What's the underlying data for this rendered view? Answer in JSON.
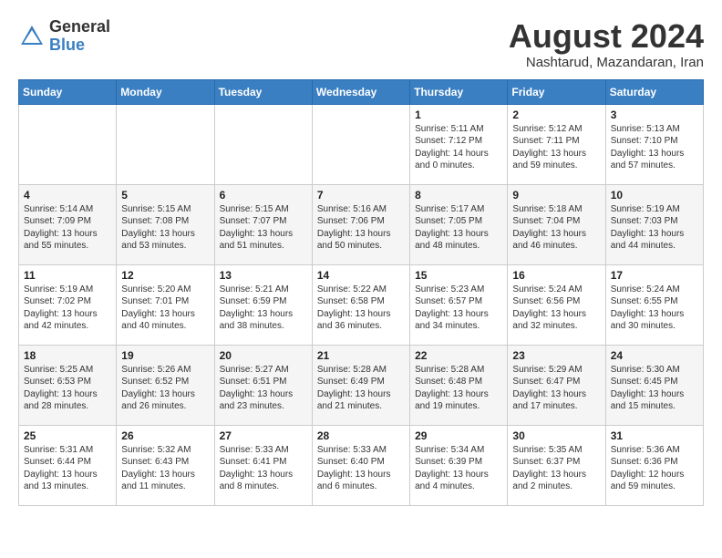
{
  "header": {
    "logo_general": "General",
    "logo_blue": "Blue",
    "title": "August 2024",
    "subtitle": "Nashtarud, Mazandaran, Iran"
  },
  "calendar": {
    "weekdays": [
      "Sunday",
      "Monday",
      "Tuesday",
      "Wednesday",
      "Thursday",
      "Friday",
      "Saturday"
    ],
    "weeks": [
      [
        {
          "day": "",
          "info": ""
        },
        {
          "day": "",
          "info": ""
        },
        {
          "day": "",
          "info": ""
        },
        {
          "day": "",
          "info": ""
        },
        {
          "day": "1",
          "info": "Sunrise: 5:11 AM\nSunset: 7:12 PM\nDaylight: 14 hours\nand 0 minutes."
        },
        {
          "day": "2",
          "info": "Sunrise: 5:12 AM\nSunset: 7:11 PM\nDaylight: 13 hours\nand 59 minutes."
        },
        {
          "day": "3",
          "info": "Sunrise: 5:13 AM\nSunset: 7:10 PM\nDaylight: 13 hours\nand 57 minutes."
        }
      ],
      [
        {
          "day": "4",
          "info": "Sunrise: 5:14 AM\nSunset: 7:09 PM\nDaylight: 13 hours\nand 55 minutes."
        },
        {
          "day": "5",
          "info": "Sunrise: 5:15 AM\nSunset: 7:08 PM\nDaylight: 13 hours\nand 53 minutes."
        },
        {
          "day": "6",
          "info": "Sunrise: 5:15 AM\nSunset: 7:07 PM\nDaylight: 13 hours\nand 51 minutes."
        },
        {
          "day": "7",
          "info": "Sunrise: 5:16 AM\nSunset: 7:06 PM\nDaylight: 13 hours\nand 50 minutes."
        },
        {
          "day": "8",
          "info": "Sunrise: 5:17 AM\nSunset: 7:05 PM\nDaylight: 13 hours\nand 48 minutes."
        },
        {
          "day": "9",
          "info": "Sunrise: 5:18 AM\nSunset: 7:04 PM\nDaylight: 13 hours\nand 46 minutes."
        },
        {
          "day": "10",
          "info": "Sunrise: 5:19 AM\nSunset: 7:03 PM\nDaylight: 13 hours\nand 44 minutes."
        }
      ],
      [
        {
          "day": "11",
          "info": "Sunrise: 5:19 AM\nSunset: 7:02 PM\nDaylight: 13 hours\nand 42 minutes."
        },
        {
          "day": "12",
          "info": "Sunrise: 5:20 AM\nSunset: 7:01 PM\nDaylight: 13 hours\nand 40 minutes."
        },
        {
          "day": "13",
          "info": "Sunrise: 5:21 AM\nSunset: 6:59 PM\nDaylight: 13 hours\nand 38 minutes."
        },
        {
          "day": "14",
          "info": "Sunrise: 5:22 AM\nSunset: 6:58 PM\nDaylight: 13 hours\nand 36 minutes."
        },
        {
          "day": "15",
          "info": "Sunrise: 5:23 AM\nSunset: 6:57 PM\nDaylight: 13 hours\nand 34 minutes."
        },
        {
          "day": "16",
          "info": "Sunrise: 5:24 AM\nSunset: 6:56 PM\nDaylight: 13 hours\nand 32 minutes."
        },
        {
          "day": "17",
          "info": "Sunrise: 5:24 AM\nSunset: 6:55 PM\nDaylight: 13 hours\nand 30 minutes."
        }
      ],
      [
        {
          "day": "18",
          "info": "Sunrise: 5:25 AM\nSunset: 6:53 PM\nDaylight: 13 hours\nand 28 minutes."
        },
        {
          "day": "19",
          "info": "Sunrise: 5:26 AM\nSunset: 6:52 PM\nDaylight: 13 hours\nand 26 minutes."
        },
        {
          "day": "20",
          "info": "Sunrise: 5:27 AM\nSunset: 6:51 PM\nDaylight: 13 hours\nand 23 minutes."
        },
        {
          "day": "21",
          "info": "Sunrise: 5:28 AM\nSunset: 6:49 PM\nDaylight: 13 hours\nand 21 minutes."
        },
        {
          "day": "22",
          "info": "Sunrise: 5:28 AM\nSunset: 6:48 PM\nDaylight: 13 hours\nand 19 minutes."
        },
        {
          "day": "23",
          "info": "Sunrise: 5:29 AM\nSunset: 6:47 PM\nDaylight: 13 hours\nand 17 minutes."
        },
        {
          "day": "24",
          "info": "Sunrise: 5:30 AM\nSunset: 6:45 PM\nDaylight: 13 hours\nand 15 minutes."
        }
      ],
      [
        {
          "day": "25",
          "info": "Sunrise: 5:31 AM\nSunset: 6:44 PM\nDaylight: 13 hours\nand 13 minutes."
        },
        {
          "day": "26",
          "info": "Sunrise: 5:32 AM\nSunset: 6:43 PM\nDaylight: 13 hours\nand 11 minutes."
        },
        {
          "day": "27",
          "info": "Sunrise: 5:33 AM\nSunset: 6:41 PM\nDaylight: 13 hours\nand 8 minutes."
        },
        {
          "day": "28",
          "info": "Sunrise: 5:33 AM\nSunset: 6:40 PM\nDaylight: 13 hours\nand 6 minutes."
        },
        {
          "day": "29",
          "info": "Sunrise: 5:34 AM\nSunset: 6:39 PM\nDaylight: 13 hours\nand 4 minutes."
        },
        {
          "day": "30",
          "info": "Sunrise: 5:35 AM\nSunset: 6:37 PM\nDaylight: 13 hours\nand 2 minutes."
        },
        {
          "day": "31",
          "info": "Sunrise: 5:36 AM\nSunset: 6:36 PM\nDaylight: 12 hours\nand 59 minutes."
        }
      ]
    ]
  }
}
